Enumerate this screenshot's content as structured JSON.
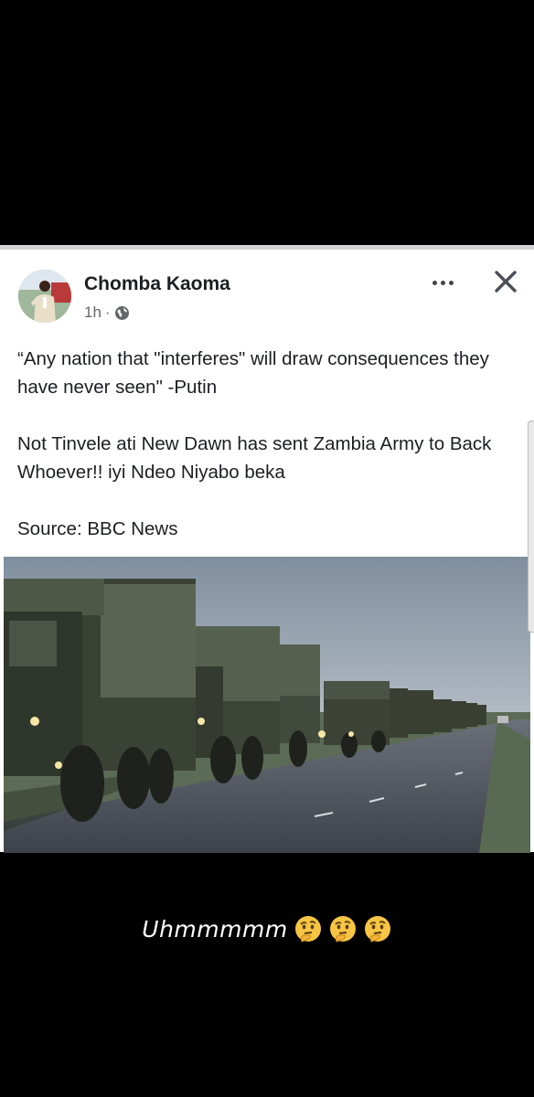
{
  "post": {
    "author": "Chomba Kaoma",
    "time": "1h",
    "separator": "·",
    "paragraphs": [
      "“Any nation that \"interferes\" will draw consequences they have never seen\" -Putin",
      "Not Tinvele ati New Dawn has sent Zambia Army to Back Whoever!! iyi Ndeo Niyabo beka",
      "Source: BBC News"
    ],
    "icons": {
      "privacy": "globe-icon",
      "more": "more-options-icon",
      "close": "close-icon"
    }
  },
  "caption": {
    "text": "Uhmmmmm",
    "emoji": [
      "thinking-face-emoji",
      "thinking-face-emoji",
      "thinking-face-emoji"
    ]
  }
}
